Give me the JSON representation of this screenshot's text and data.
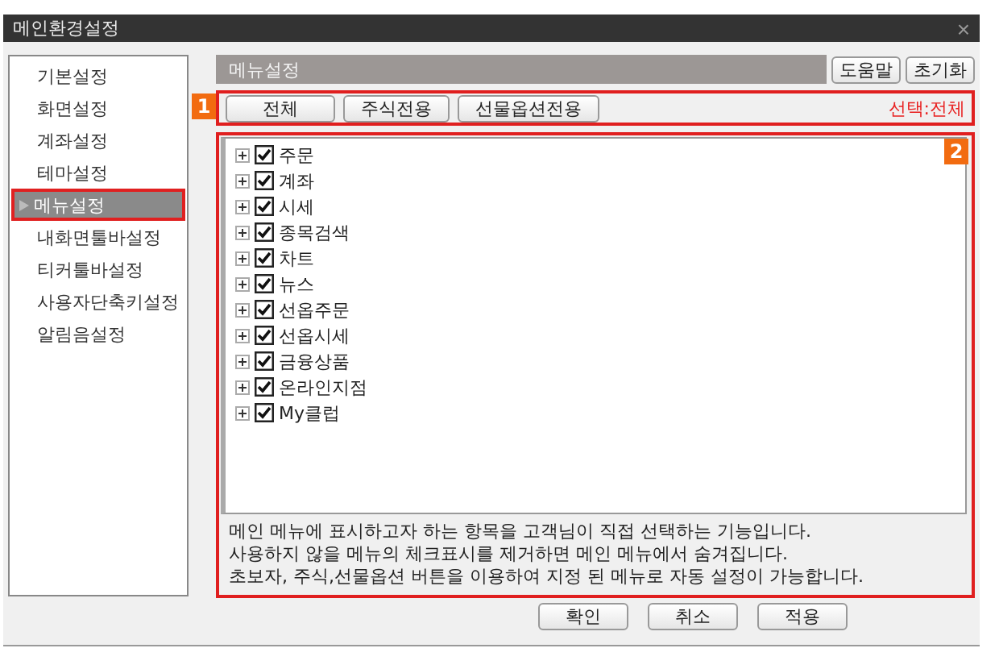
{
  "window": {
    "title": "메인환경설정",
    "close": "×"
  },
  "sidebar": {
    "items": [
      {
        "label": "기본설정",
        "selected": false
      },
      {
        "label": "화면설정",
        "selected": false
      },
      {
        "label": "계좌설정",
        "selected": false
      },
      {
        "label": "테마설정",
        "selected": false
      },
      {
        "label": "메뉴설정",
        "selected": true
      },
      {
        "label": "내화면툴바설정",
        "selected": false
      },
      {
        "label": "티커툴바설정",
        "selected": false
      },
      {
        "label": "사용자단축키설정",
        "selected": false
      },
      {
        "label": "알림음설정",
        "selected": false
      }
    ]
  },
  "header": {
    "title": "메뉴설정",
    "buttons": [
      "도움말",
      "초기화"
    ]
  },
  "annotations": [
    "1",
    "2"
  ],
  "filter": {
    "buttons": [
      "전체",
      "주식전용",
      "선물옵션전용"
    ],
    "selection": "선택:전체"
  },
  "tree": {
    "items": [
      {
        "label": "주문",
        "checked": true,
        "expanded": false
      },
      {
        "label": "계좌",
        "checked": true,
        "expanded": false
      },
      {
        "label": "시세",
        "checked": true,
        "expanded": false
      },
      {
        "label": "종목검색",
        "checked": true,
        "expanded": false
      },
      {
        "label": "차트",
        "checked": true,
        "expanded": false
      },
      {
        "label": "뉴스",
        "checked": true,
        "expanded": false
      },
      {
        "label": "선옵주문",
        "checked": true,
        "expanded": false
      },
      {
        "label": "선옵시세",
        "checked": true,
        "expanded": false
      },
      {
        "label": "금융상품",
        "checked": true,
        "expanded": false
      },
      {
        "label": "온라인지점",
        "checked": true,
        "expanded": false
      },
      {
        "label": "My클럽",
        "checked": true,
        "expanded": false
      }
    ]
  },
  "description": [
    "메인 메뉴에 표시하고자 하는 항목을  고객님이 직접 선택하는 기능입니다.",
    "사용하지 않을 메뉴의 체크표시를 제거하면 메인 메뉴에서 숨겨집니다.",
    "초보자, 주식,선물옵션 버튼을 이용하여 지정 된 메뉴로 자동 설정이 가능합니다."
  ],
  "footer": {
    "buttons": [
      "확인",
      "취소",
      "적용"
    ]
  }
}
